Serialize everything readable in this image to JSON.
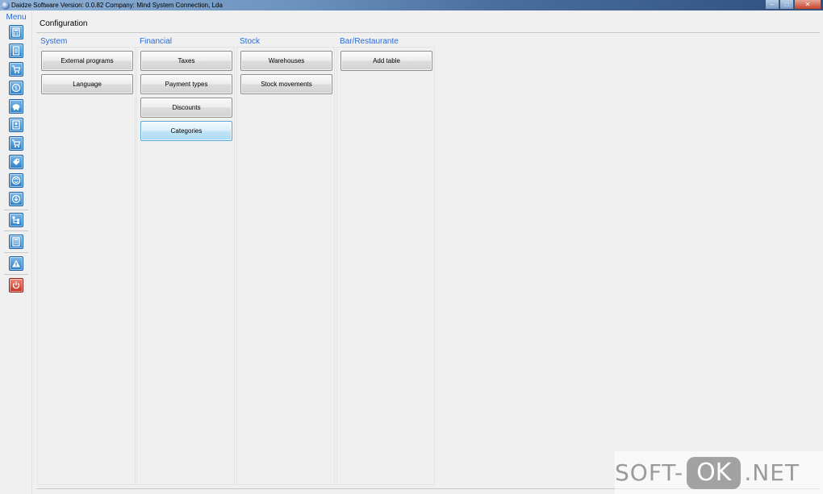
{
  "window": {
    "title": "Daidze Software Version: 0.0.82 Company: Mind System Connection, Lda"
  },
  "menu": {
    "label": "Menu"
  },
  "page": {
    "title": "Configuration"
  },
  "groups": [
    {
      "title": "System",
      "buttons": [
        "External programs",
        "Language"
      ]
    },
    {
      "title": "Financial",
      "buttons": [
        "Taxes",
        "Payment types",
        "Discounts",
        "Categories"
      ]
    },
    {
      "title": "Stock",
      "buttons": [
        "Warehouses",
        "Stock movements"
      ]
    },
    {
      "title": "Bar/Restaurante",
      "buttons": [
        "Add table"
      ]
    }
  ],
  "selected_button": "Categories",
  "watermark": {
    "prefix": "SOFT-",
    "badge": "OK",
    "suffix": ".NET"
  },
  "colors": {
    "accent_text": "#2a6ad8",
    "menu_icon": "#2a7fc8",
    "power_icon": "#c8301f",
    "selected_button": "#c2e4f7"
  }
}
